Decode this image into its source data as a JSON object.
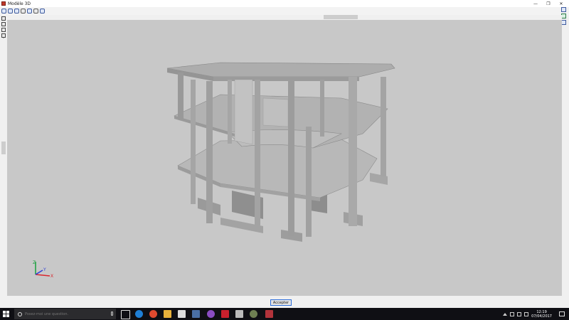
{
  "window": {
    "title": "Modèle 3D",
    "controls": {
      "minimize": "—",
      "restore": "❐",
      "close": "✕"
    }
  },
  "toolbar": {
    "icons": [
      "zoom-window-icon",
      "zoom-extents-icon",
      "zoom-in-icon",
      "zoom-previous-icon",
      "orbit-icon",
      "pan-hand-icon",
      "refresh-icon"
    ]
  },
  "left_toolbar": {
    "icons": [
      "measure-icon",
      "print-icon",
      "layers-icon",
      "render-icon"
    ],
    "arrows": [
      "˄",
      "˅"
    ]
  },
  "viewport": {
    "background": "#c8c8c8",
    "axes": {
      "x": "X",
      "y": "Y",
      "z": "Z"
    }
  },
  "statusbar": {
    "accept_label": "Accepter"
  },
  "taskbar": {
    "search_placeholder": "Posez-moi une question.",
    "clock_time": "12:19",
    "clock_date": "07/04/2017",
    "apps": [
      "task-view-icon",
      "edge-icon",
      "chrome-icon",
      "file-explorer-icon",
      "store-icon",
      "photos-icon",
      "app-icon",
      "autocad-icon",
      "calculator-icon",
      "app-icon-2",
      "structure-app-icon"
    ]
  }
}
